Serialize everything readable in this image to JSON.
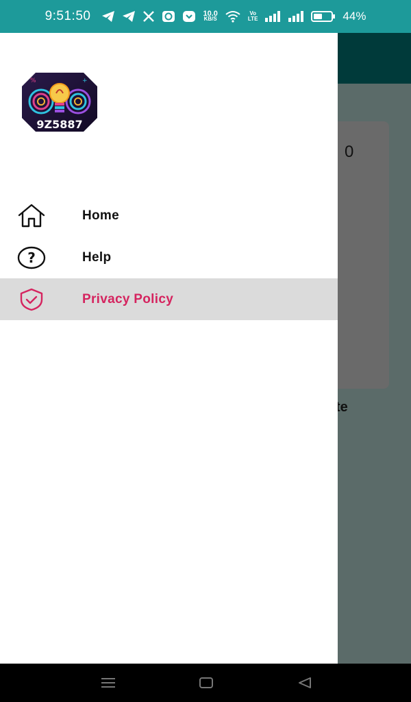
{
  "status_bar": {
    "time": "9:51:50",
    "net_speed_value": "10.0",
    "net_speed_unit": "KB/S",
    "volte_top": "Vo",
    "volte_bottom": "LTE",
    "battery_percent": "44%",
    "bg_color": "#1d9a9a"
  },
  "logo": {
    "text": "9Z5887",
    "icon": "lightbulb-logo"
  },
  "drawer": {
    "items": [
      {
        "label": "Home",
        "icon": "home-icon",
        "active": false
      },
      {
        "label": "Help",
        "icon": "help-circle-icon",
        "active": false
      },
      {
        "label": "Privacy Policy",
        "icon": "shield-check-icon",
        "active": true
      }
    ],
    "active_color": "#d5245f"
  },
  "background": {
    "card_value": "0",
    "label_fragment": "te"
  },
  "nav_bar": {
    "buttons": [
      "menu-icon",
      "home-square-icon",
      "back-triangle-icon"
    ]
  }
}
